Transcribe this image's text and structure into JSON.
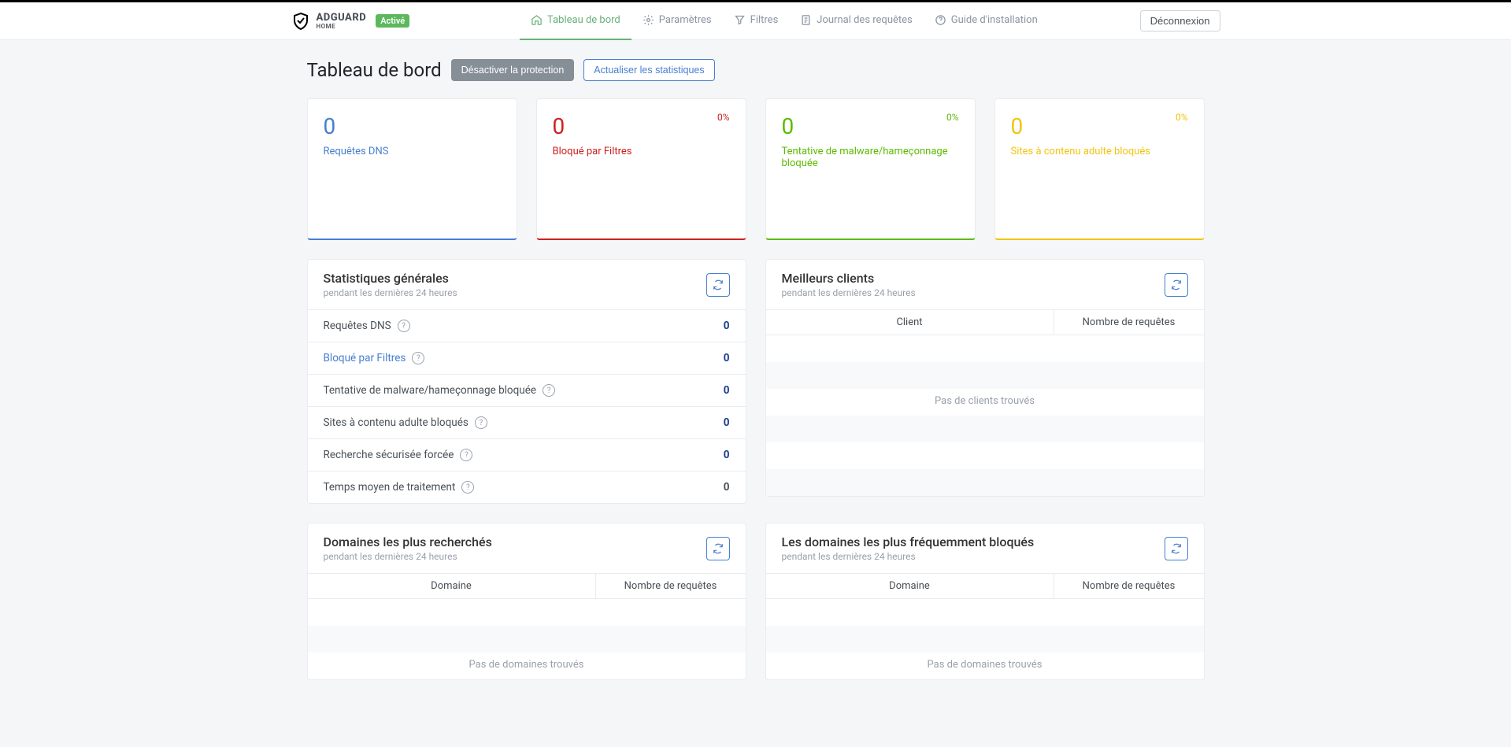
{
  "brand": {
    "name": "ADGUARD",
    "sub": "HOME",
    "status": "Activé"
  },
  "nav": {
    "dashboard": "Tableau de bord",
    "settings": "Paramètres",
    "filters": "Filtres",
    "querylog": "Journal des requêtes",
    "guide": "Guide d'installation"
  },
  "logout": "Déconnexion",
  "page": {
    "title": "Tableau de bord",
    "disable": "Désactiver la protection",
    "refresh": "Actualiser les statistiques"
  },
  "cards": {
    "dns": {
      "value": "0",
      "label": "Requêtes DNS"
    },
    "blocked": {
      "value": "0",
      "label": "Bloqué par Filtres",
      "pct": "0%"
    },
    "malware": {
      "value": "0",
      "label": "Tentative de malware/hameçonnage bloquée",
      "pct": "0%"
    },
    "adult": {
      "value": "0",
      "label": "Sites à contenu adulte bloqués",
      "pct": "0%"
    }
  },
  "stats": {
    "title": "Statistiques générales",
    "subtitle": "pendant les dernières 24 heures",
    "rows": {
      "dns": {
        "label": "Requêtes DNS",
        "value": "0"
      },
      "blocked": {
        "label": "Bloqué par Filtres",
        "value": "0"
      },
      "malware": {
        "label": "Tentative de malware/hameçonnage bloquée",
        "value": "0"
      },
      "adult": {
        "label": "Sites à contenu adulte bloqués",
        "value": "0"
      },
      "safesearch": {
        "label": "Recherche sécurisée forcée",
        "value": "0"
      },
      "avgtime": {
        "label": "Temps moyen de traitement",
        "value": "0"
      }
    }
  },
  "clients": {
    "title": "Meilleurs clients",
    "subtitle": "pendant les dernières 24 heures",
    "col1": "Client",
    "col2": "Nombre de requêtes",
    "empty": "Pas de clients trouvés"
  },
  "queried": {
    "title": "Domaines les plus recherchés",
    "subtitle": "pendant les dernières 24 heures",
    "col1": "Domaine",
    "col2": "Nombre de requêtes",
    "empty": "Pas de domaines trouvés"
  },
  "blocked_domains": {
    "title": "Les domaines les plus fréquemment bloqués",
    "subtitle": "pendant les dernières 24 heures",
    "col1": "Domaine",
    "col2": "Nombre de requêtes",
    "empty": "Pas de domaines trouvés"
  }
}
